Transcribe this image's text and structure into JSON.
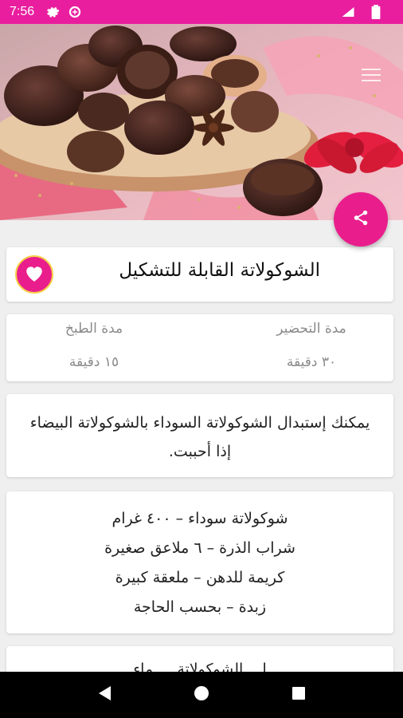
{
  "status_bar": {
    "time": "7:56",
    "icons": [
      "settings-gear-icon",
      "data-saver-icon",
      "wifi-icon",
      "battery-icon"
    ],
    "color": "#e91e9e"
  },
  "hero": {
    "image": "chocolate-bonbons-photo",
    "menu_icon": "overflow-menu-icon"
  },
  "share_button": {
    "icon": "share-icon",
    "color": "#e91e8c"
  },
  "recipe": {
    "title": "الشوكولاتة القابلة للتشكيل",
    "favorite_icon": "heart-icon",
    "prep_label": "مدة التحضير",
    "prep_value": "٣٠ دقيقة",
    "cook_label": "مدة الطبخ",
    "cook_value": "١٥ دقيقة",
    "tip": "يمكنك إستبدال الشوكولاتة السوداء بالشوكولاتة البيضاء إذا أحببت.",
    "ingredients": [
      "شوكولاتة سوداء – ٤٠٠ غرام",
      "شراب الذرة – ٦ ملاعق صغيرة",
      "كريمة للدهن – ملعقة كبيرة",
      "زبدة – بحسب الحاجة"
    ],
    "next_step": "إ... الشوكولاتة ... ماء"
  },
  "nav_bar": {
    "back": "back-icon",
    "home": "home-icon",
    "recents": "recents-icon"
  }
}
